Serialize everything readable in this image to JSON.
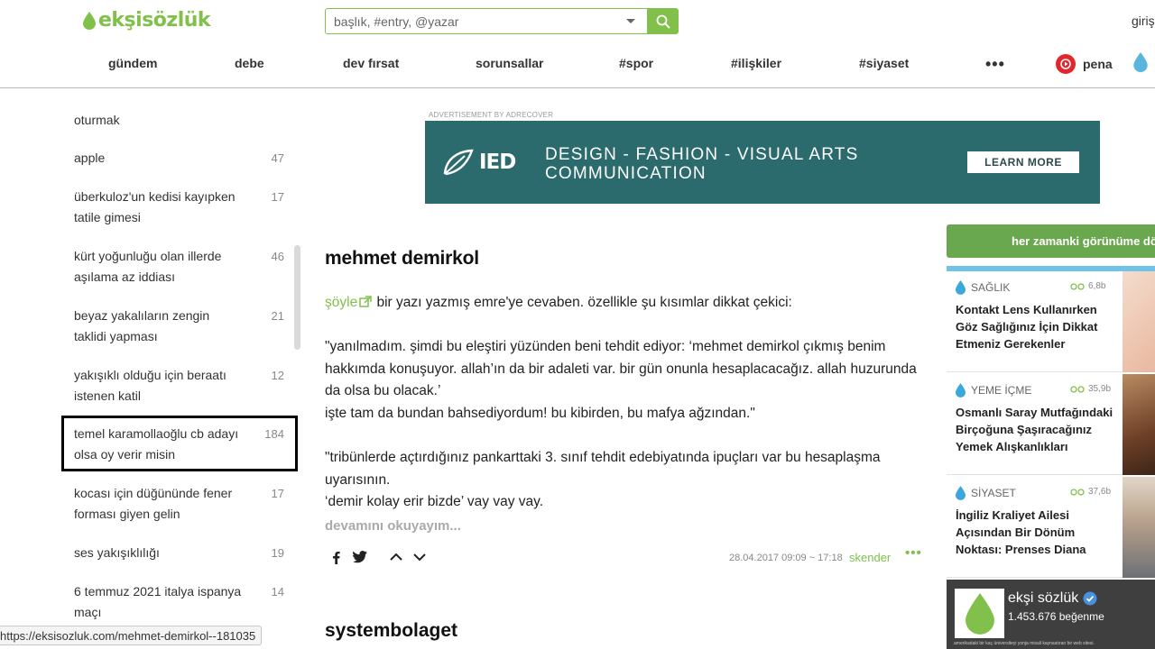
{
  "header": {
    "logo_text": "ekşisözlük",
    "search_placeholder": "başlık, #entry, @yazar",
    "login_label": "giriş",
    "nav": [
      {
        "label": "gündem"
      },
      {
        "label": "debe"
      },
      {
        "label": "dev fırsat"
      },
      {
        "label": "sorunsallar"
      },
      {
        "label": "#spor"
      },
      {
        "label": "#ilişkiler"
      },
      {
        "label": "#siyaset"
      }
    ],
    "more_label": "•••",
    "pena_label": "pena"
  },
  "sidebar": {
    "items": [
      {
        "label": "oturmak",
        "count": ""
      },
      {
        "label": "apple",
        "count": "47"
      },
      {
        "label": "überkuloz'un kedisi kayıpken tatile gimesi",
        "count": "17"
      },
      {
        "label": "kürt yoğunluğu olan illerde aşılama az iddiası",
        "count": "46"
      },
      {
        "label": "beyaz yakalıların zengin taklidi yapması",
        "count": "21"
      },
      {
        "label": "yakışıklı olduğu için beraatı istenen katil",
        "count": "12"
      },
      {
        "label": "temel karamollaoğlu cb adayı olsa oy verir misin",
        "count": "184"
      },
      {
        "label": "kocası için düğününde fener forması giyen gelin",
        "count": "17"
      },
      {
        "label": "ses yakışıklılığı",
        "count": "19"
      },
      {
        "label": "6 temmuz 2021 italya ispanya maçı",
        "count": "14"
      }
    ]
  },
  "ad": {
    "label": "ADVERTISEMENT BY ADRECOVER",
    "brand": "IED",
    "line1": "DESIGN - FASHION  - VISUAL ARTS",
    "line2": "COMMUNICATION",
    "cta": "LEARN MORE"
  },
  "entry": {
    "title": "mehmet demirkol",
    "link_text": "şöyle",
    "intro_rest": " bir yazı yazmış emre'ye cevaben. özellikle şu kısımlar dikkat çekici:",
    "quote1": "\"yanılmadım. şimdi bu eleştiri yüzünden beni tehdit ediyor: ‘mehmet demirkol çıkmış benim hakkımda konuşuyor. allah’ın da bir adaleti var. bir gün onunla hesaplacacağız. allah huzurunda da olsa bu olacak.’",
    "quote1b": "işte tam da bundan bahsediyordum! bu kibirden, bu mafya ağzından.\"",
    "quote2": "\"tribünlerde açtırdığınız pankarttaki 3. sınıf tehdit edebiyatında ipuçları var bu hesaplaşma uyarısının.",
    "quote2b": "‘demir kolay erir bizde’ vay vay vay.",
    "read_more": "devamını okuyayım...",
    "date": "28.04.2017 09:09 ~ 17:18",
    "author": "skender",
    "more_dots": "•••"
  },
  "next_entry_title": "systembolaget",
  "right": {
    "view_button": "her zamanki görünüme dön",
    "cards": [
      {
        "category": "SAĞLIK",
        "views": "6,8b",
        "title": "Kontakt Lens Kullanırken Göz Sağlığınız İçin Dikkat Etmeniz Gerekenler",
        "thumb": "#f2d3c1"
      },
      {
        "category": "YEME İÇME",
        "views": "35,9b",
        "title": "Osmanlı Saray Mutfağındaki Birçoğuna Şaşıracağınız Yemek Alışkanlıkları",
        "thumb": "#8c5a3a"
      },
      {
        "category": "SİYASET",
        "views": "37,6b",
        "title": "İngiliz Kraliyet Ailesi Açısından Bir Dönüm Noktası: Prenses Diana",
        "thumb": "#c8b8a6"
      }
    ],
    "fb_name": "ekşi sözlük",
    "fb_likes": "1.453.676 beğenme",
    "fb_strip": "amerikadaki bir kaç üniversiteyi yonja misali kaynastıran bir web sitesi."
  },
  "status_url": "https://eksisozluk.com/mehmet-demirkol--181035",
  "colors": {
    "brand": "#81c14b",
    "ad_bg": "#2b6b6d",
    "pena": "#e3262b",
    "accent_blue": "#6fc3e8"
  }
}
